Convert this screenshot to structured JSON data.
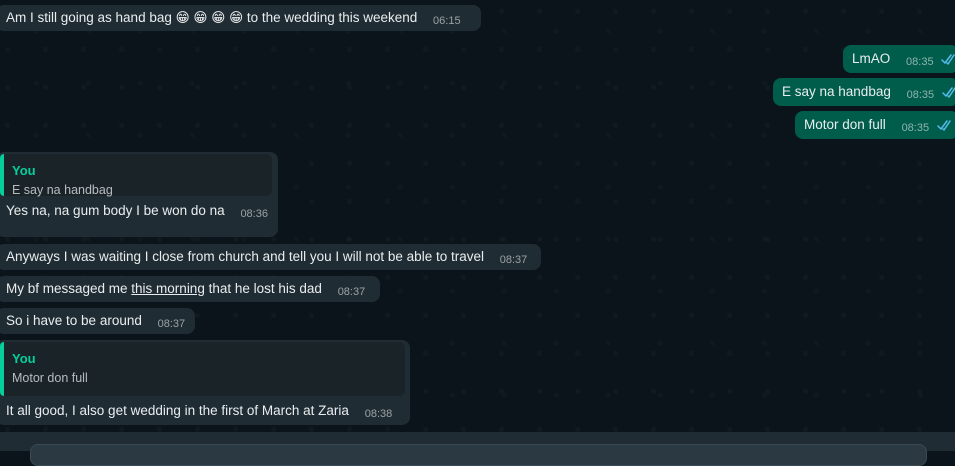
{
  "messages": [
    {
      "id": "m1",
      "dir": "in",
      "text": "Am I still going as hand bag 😁 😁 😁 😁 to the wedding this weekend",
      "time": "06:15"
    },
    {
      "id": "m2",
      "dir": "out",
      "text": "LmAO",
      "time": "08:35",
      "read": true
    },
    {
      "id": "m3",
      "dir": "out",
      "text": "E say na handbag",
      "time": "08:35",
      "read": true
    },
    {
      "id": "m4",
      "dir": "out",
      "text": "Motor don full",
      "time": "08:35",
      "read": true
    },
    {
      "id": "m5",
      "dir": "in",
      "quote": {
        "author": "You",
        "text": "E say na handbag"
      },
      "text": "Yes na, na gum body I be won do na",
      "time": "08:36"
    },
    {
      "id": "m6",
      "dir": "in",
      "text": "Anyways I was waiting I close from church and tell you I will not be able to travel",
      "time": "08:37"
    },
    {
      "id": "m7",
      "dir": "in",
      "text_before": "My bf messaged me ",
      "text_link": "this morning",
      "text_after": " that he lost his dad",
      "time": "08:37"
    },
    {
      "id": "m8",
      "dir": "in",
      "text": "So i have to be around",
      "time": "08:37"
    },
    {
      "id": "m9",
      "dir": "in",
      "quote": {
        "author": "You",
        "text": "Motor don full"
      },
      "text": "It all good, I also get wedding in the first of March at Zaria",
      "time": "08:38"
    }
  ],
  "colors": {
    "background": "#0b141a",
    "incoming_bubble": "#202c33",
    "outgoing_bubble": "#005c4b",
    "quote_accent": "#06cf9c",
    "read_ticks": "#53bdeb"
  },
  "icons": {
    "read_receipt": "double-check-icon"
  }
}
